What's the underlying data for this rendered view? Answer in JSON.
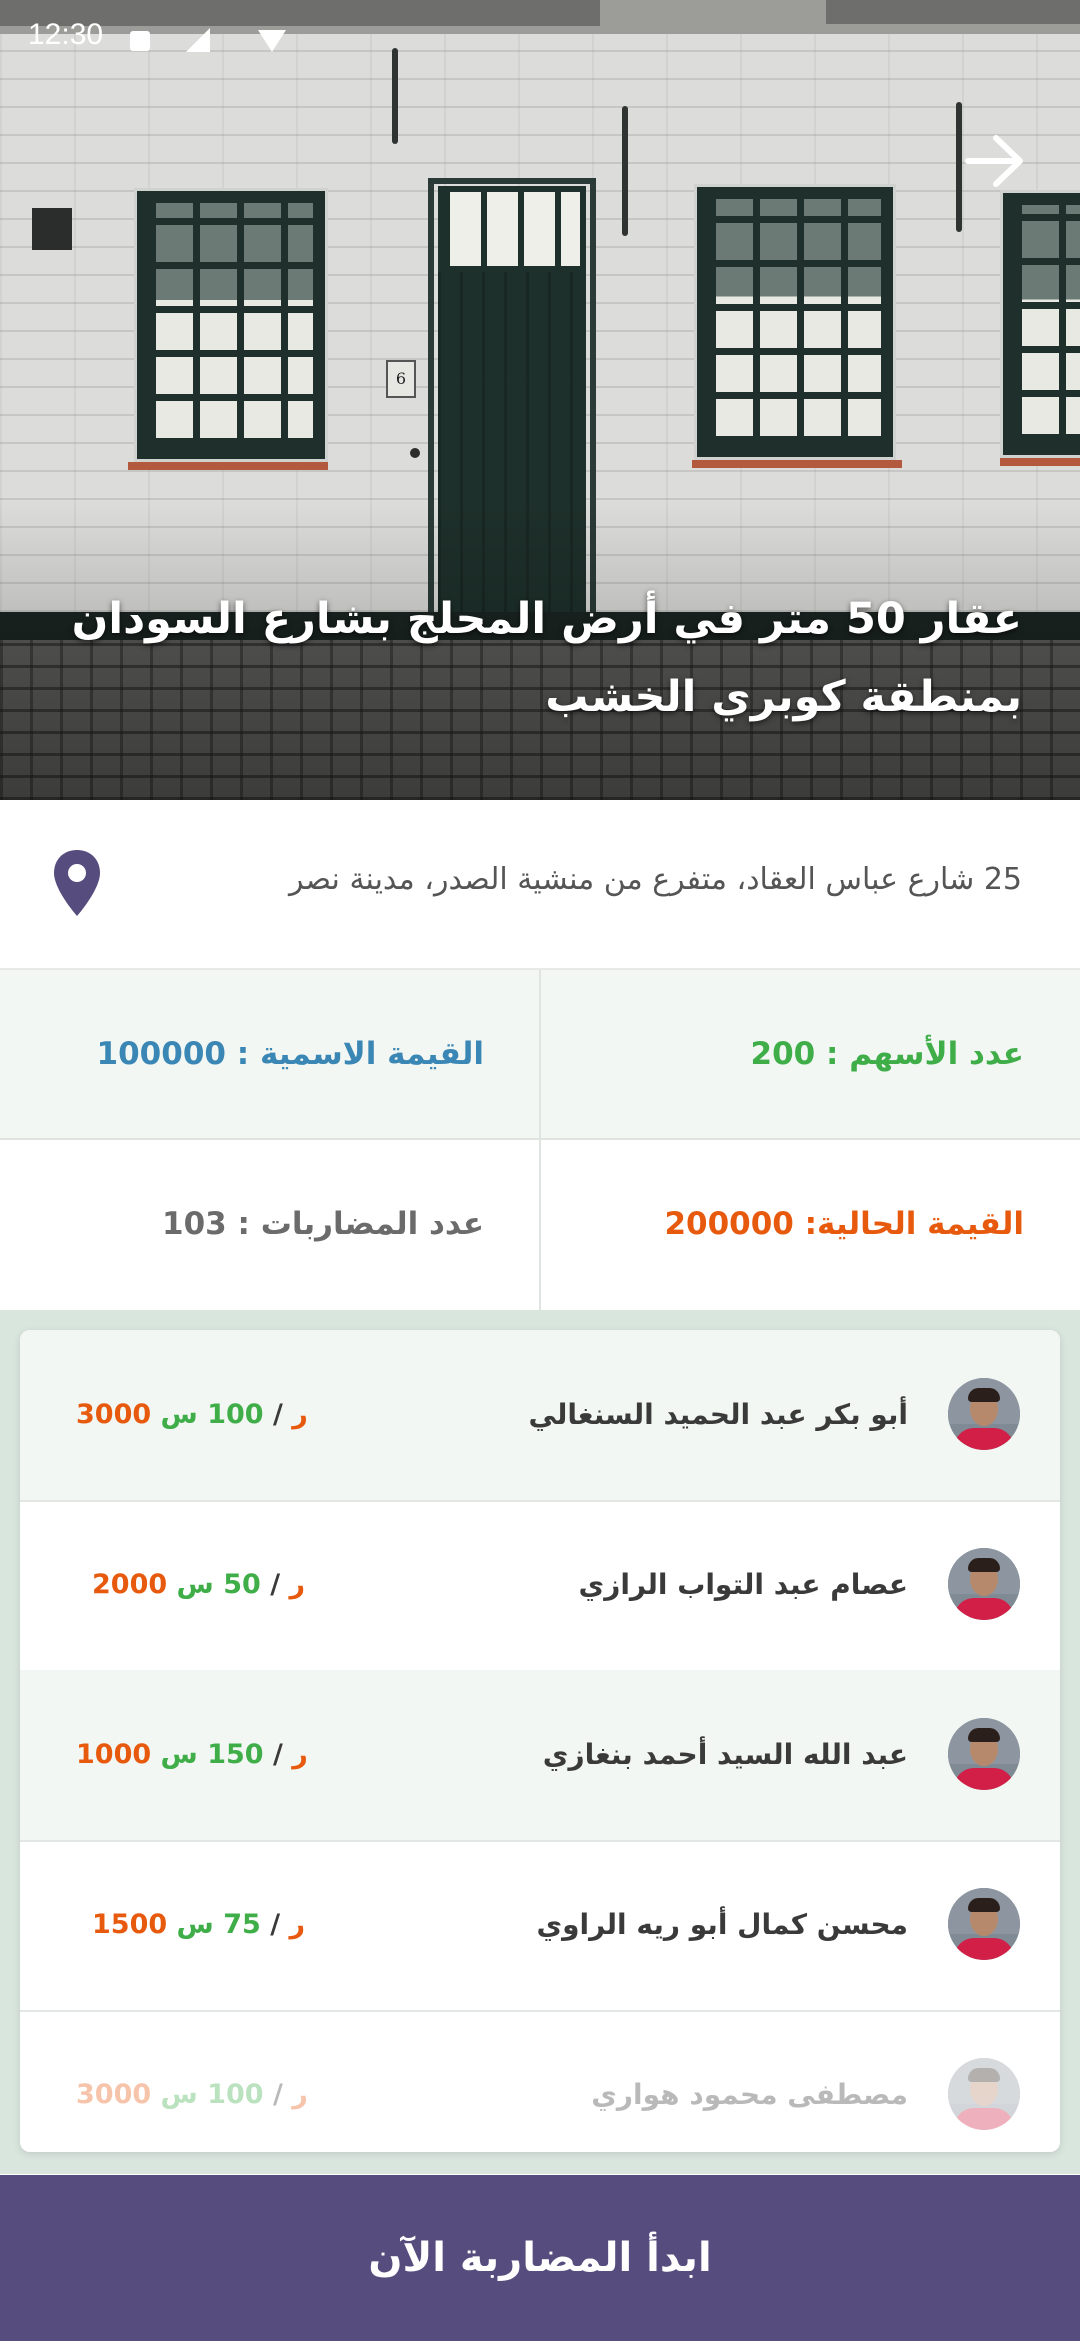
{
  "status_bar": {
    "time": "12:30"
  },
  "hero": {
    "title": "عقار 50 متر في أرض المحلج بشارع السودان بمنطقة كوبري الخشب",
    "house_number": "6"
  },
  "address": "25 شارع عباس العقاد، متفرع من منشية الصدر، مدينة نصر",
  "stats": {
    "shares_count": "عدد الأسهم : 200",
    "nominal_value": "القيمة الاسمية : 100000",
    "current_value": "القيمة الحالية: 200000",
    "speculations_count": "عدد المضاربات : 103"
  },
  "colors": {
    "primary": "#564c7d",
    "shares_green": "#3fae49",
    "nominal_blue": "#3a86b4",
    "current_orange": "#e75a0e",
    "count_grey": "#6b6b6b",
    "row_tint": "#f2f7f3"
  },
  "bids": [
    {
      "name": "أبو بكر عبد الحميد السنغالي",
      "shares": "100 س",
      "money": "3000 ر"
    },
    {
      "name": "عصام عبد التواب الرازي",
      "shares": "50 س",
      "money": "2000 ر"
    },
    {
      "name": "عبد الله السيد أحمد بنغازي",
      "shares": "150 س",
      "money": "1000 ر"
    },
    {
      "name": "محسن كمال أبو ريه الراوي",
      "shares": "75 س",
      "money": "1500 ر"
    },
    {
      "name": "مصطفى محمود هواري",
      "shares": "100 س",
      "money": "3000 ر"
    }
  ],
  "separator": "/",
  "icons": {
    "forward": "arrow-right-icon",
    "location": "map-pin-icon"
  },
  "cta": {
    "label": "ابدأ المضاربة الآن"
  }
}
